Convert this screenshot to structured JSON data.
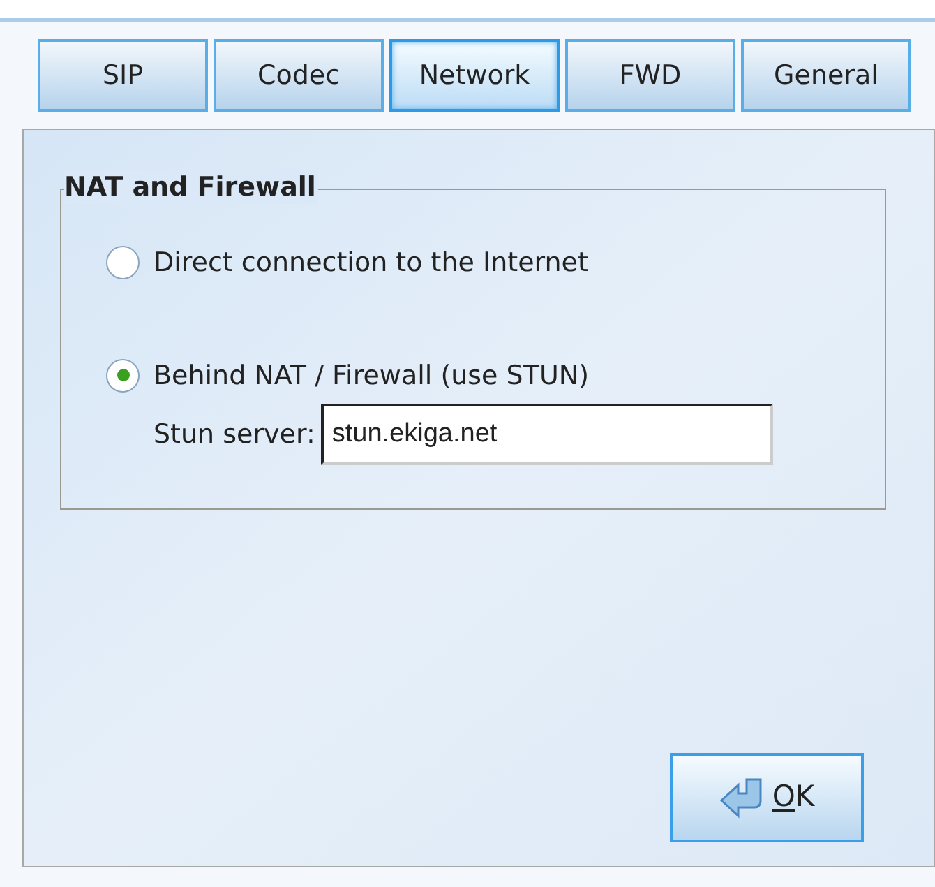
{
  "tabs": [
    {
      "label": "SIP",
      "selected": false
    },
    {
      "label": "Codec",
      "selected": false
    },
    {
      "label": "Network",
      "selected": true
    },
    {
      "label": "FWD",
      "selected": false
    },
    {
      "label": "General",
      "selected": false
    }
  ],
  "group": {
    "title": "NAT and Firewall",
    "options": [
      {
        "label": "Direct connection to the Internet",
        "selected": false
      },
      {
        "label": "Behind NAT / Firewall (use STUN)",
        "selected": true
      }
    ],
    "stun": {
      "label": "Stun server:",
      "value": "stun.ekiga.net"
    }
  },
  "ok_button": {
    "mnemonic": "O",
    "rest": "K"
  }
}
